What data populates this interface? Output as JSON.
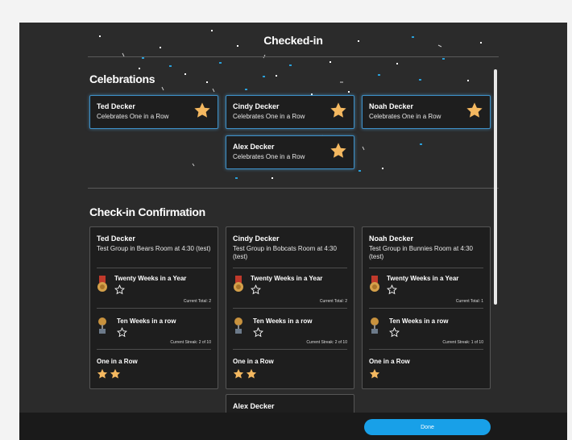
{
  "header": {
    "title": "Checked-in"
  },
  "celebrations": {
    "title": "Celebrations",
    "cards": [
      {
        "name": "Ted Decker",
        "text": "Celebrates One in a Row"
      },
      {
        "name": "Cindy Decker",
        "text": "Celebrates One in a Row"
      },
      {
        "name": "Noah Decker",
        "text": "Celebrates One in a Row"
      },
      {
        "name": "Alex Decker",
        "text": "Celebrates One in a Row"
      }
    ]
  },
  "confirmation": {
    "title": "Check-in Confirmation",
    "cards": [
      {
        "name": "Ted Decker",
        "group": "Test Group in Bears Room at 4:30 (test)",
        "ach1": {
          "title": "Twenty Weeks in a Year",
          "stat": "Current Total: 2"
        },
        "ach2": {
          "title": "Ten Weeks in a row",
          "stat": "Current Streak: 2 of 10"
        },
        "row": {
          "title": "One in a Row",
          "stars": 2
        }
      },
      {
        "name": "Cindy Decker",
        "group": "Test Group in Bobcats Room at 4:30 (test)",
        "ach1": {
          "title": "Twenty Weeks in a Year",
          "stat": "Current Total: 2"
        },
        "ach2": {
          "title": "Ten Weeks in a row",
          "stat": "Current Streak: 2 of 10"
        },
        "row": {
          "title": "One in a Row",
          "stars": 2
        }
      },
      {
        "name": "Noah Decker",
        "group": "Test Group in Bunnies Room at 4:30 (test)",
        "ach1": {
          "title": "Twenty Weeks in a Year",
          "stat": "Current Total: 1"
        },
        "ach2": {
          "title": "Ten Weeks in a row",
          "stat": "Current Streak: 1 of 10"
        },
        "row": {
          "title": "One in a Row",
          "stars": 1
        }
      },
      {
        "name": "Alex Decker"
      }
    ]
  },
  "footer": {
    "done_label": "Done"
  },
  "icons": {
    "celebration": "star-icon",
    "medal": "medal-icon",
    "trophy": "trophy-icon",
    "achievement": "star-outline-icon"
  },
  "colors": {
    "accent": "#18a0e8",
    "star": "#f4b860",
    "card_glow": "#3d8fc7",
    "background": "#2b2b2b"
  }
}
